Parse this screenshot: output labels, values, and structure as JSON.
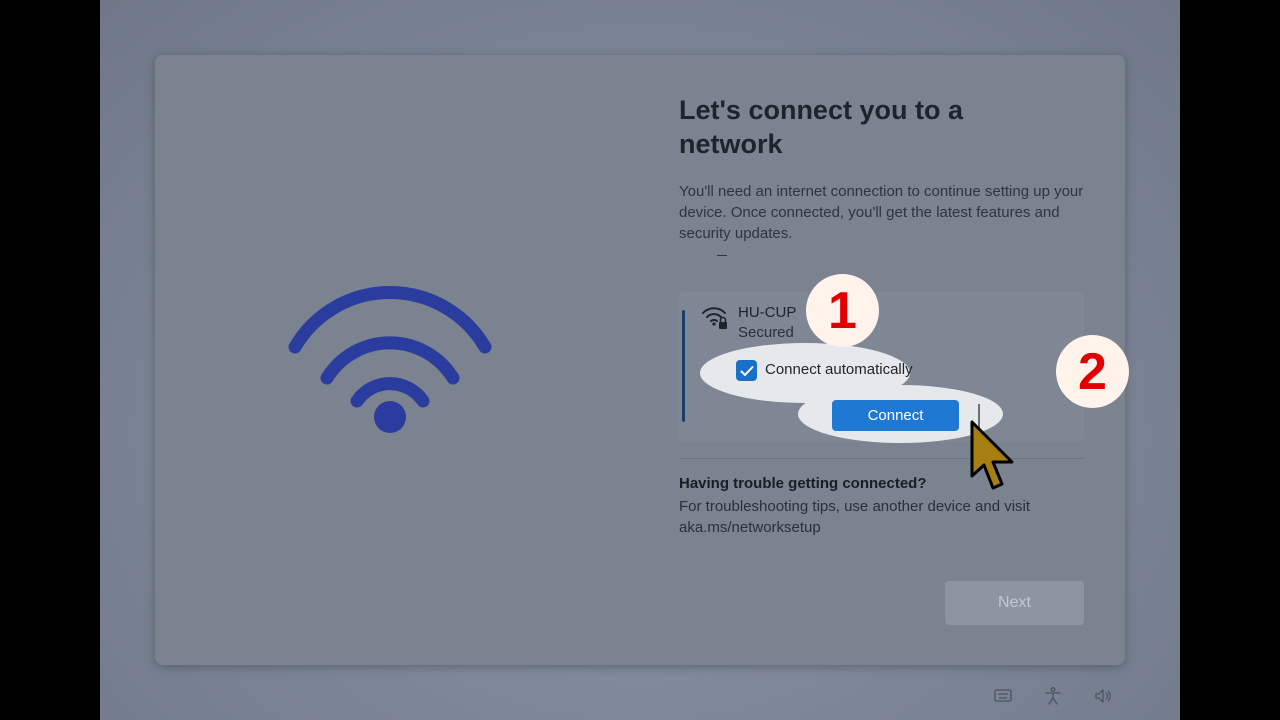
{
  "page": {
    "title": "Let's connect you to a network",
    "description": "You'll need an internet connection to continue setting up your device. Once connected, you'll get the latest features and security updates.",
    "dash": "–"
  },
  "network": {
    "name": "HU-CUP",
    "status": "Secured",
    "auto_connect_label": "Connect automatically",
    "auto_connect_checked": true,
    "connect_label": "Connect"
  },
  "trouble": {
    "title": "Having trouble getting connected?",
    "text": "For troubleshooting tips, use another device and visit aka.ms/networksetup"
  },
  "footer": {
    "next_label": "Next"
  },
  "annotations": {
    "step1": "1",
    "step2": "2"
  },
  "system_tray": [
    "keyboard-icon",
    "accessibility-icon",
    "volume-icon"
  ],
  "colors": {
    "accent": "#1f78d1",
    "wifi_hero": "#2a3d9e",
    "badge_text": "#e00000",
    "cursor": "#a57f12"
  }
}
